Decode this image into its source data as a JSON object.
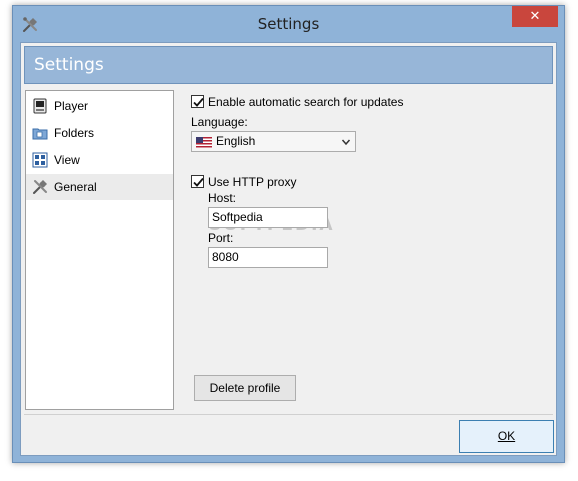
{
  "window": {
    "title": "Settings",
    "close_glyph": "✕",
    "icon": "tools-icon"
  },
  "header": {
    "title": "Settings"
  },
  "sidebar": {
    "items": [
      {
        "label": "Player",
        "icon": "player-icon",
        "selected": false
      },
      {
        "label": "Folders",
        "icon": "folder-icon",
        "selected": false
      },
      {
        "label": "View",
        "icon": "view-icon",
        "selected": false
      },
      {
        "label": "General",
        "icon": "tools-icon",
        "selected": true
      }
    ]
  },
  "general": {
    "auto_update": {
      "label": "Enable automatic search for updates",
      "checked": true
    },
    "language": {
      "label": "Language:",
      "value": "English",
      "flag": "us-flag-icon"
    },
    "proxy": {
      "label": "Use HTTP proxy",
      "checked": true,
      "host_label": "Host:",
      "host_value": "Softpedia",
      "port_label": "Port:",
      "port_value": "8080"
    },
    "delete_profile_label": "Delete profile"
  },
  "footer": {
    "ok_label": "OK"
  },
  "colors": {
    "frame": "#8fb3d8",
    "header_band": "#97b6d8",
    "close_button": "#c9463d",
    "client_bg": "#f0f0f0",
    "selected_item": "#ebebeb"
  }
}
